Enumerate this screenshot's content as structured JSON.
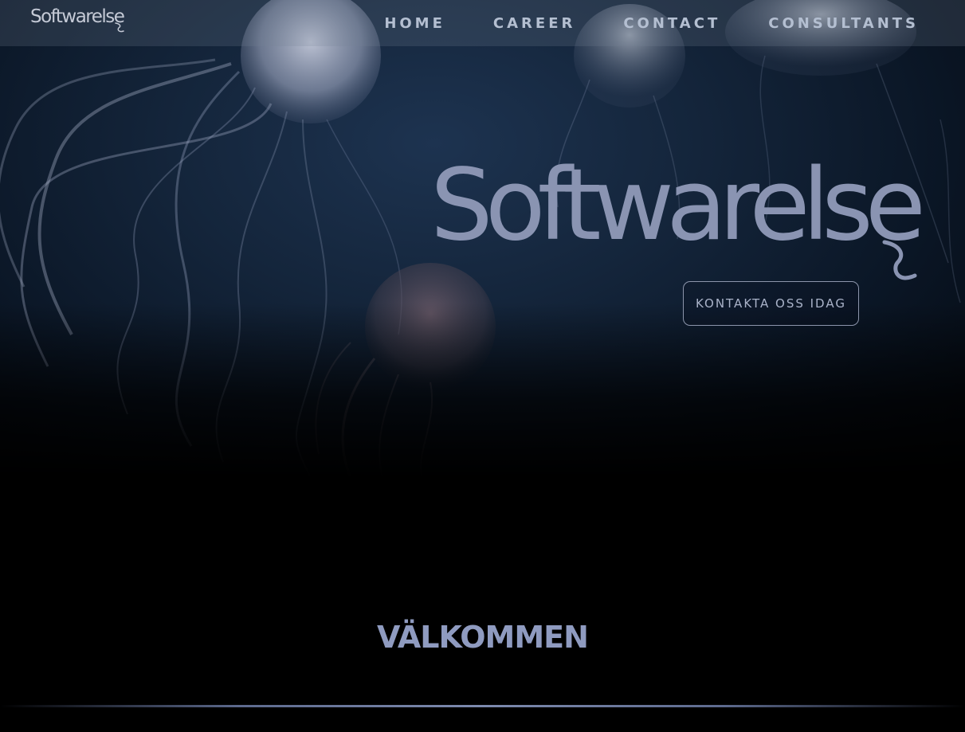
{
  "nav": {
    "logo_text": "Softwarelse",
    "links": [
      {
        "label": "HOME"
      },
      {
        "label": "CAREER"
      },
      {
        "label": "CONTACT"
      },
      {
        "label": "CONSULTANTS"
      }
    ]
  },
  "hero": {
    "wordmark": "Softwarelse",
    "cta_label": "KONTAKTA OSS IDAG",
    "background_image": "jellyfish-underwater"
  },
  "welcome": {
    "heading": "VÄLKOMMEN"
  },
  "colors": {
    "brand": "#8a94b2",
    "nav_text": "#b4bfd1",
    "heading": "#8f9bc0",
    "background": "#000000"
  }
}
